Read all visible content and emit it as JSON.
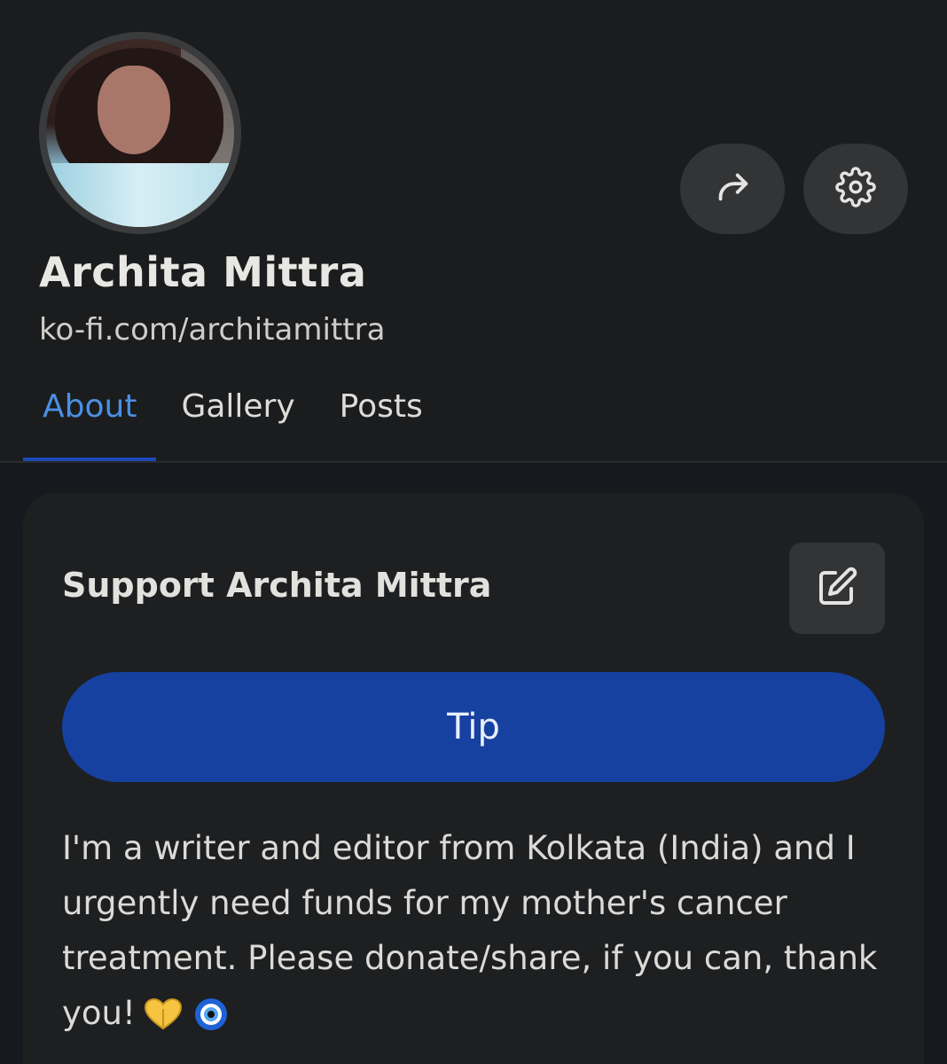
{
  "profile": {
    "name": "Archita Mittra",
    "url": "ko-fi.com/architamittra",
    "avatar_icon": "profile-photo"
  },
  "actions": {
    "share_icon": "share-arrow-icon",
    "settings_icon": "gear-icon"
  },
  "tabs": [
    {
      "label": "About",
      "active": true
    },
    {
      "label": "Gallery",
      "active": false
    },
    {
      "label": "Posts",
      "active": false
    }
  ],
  "support": {
    "title": "Support Archita Mittra",
    "edit_icon": "edit-icon",
    "tip_label": "Tip",
    "bio": "I'm a writer and editor from Kolkata (India) and I urgently need funds for my mother's cancer treatment. Please donate/share, if you can, thank you!",
    "bio_emojis": [
      "heart-hands-emoji",
      "nazar-amulet-emoji"
    ]
  },
  "colors": {
    "accent": "#4a90e2",
    "tip_button": "#1641a0",
    "tab_underline": "#1b49b8",
    "background": "#1b1c1e"
  }
}
